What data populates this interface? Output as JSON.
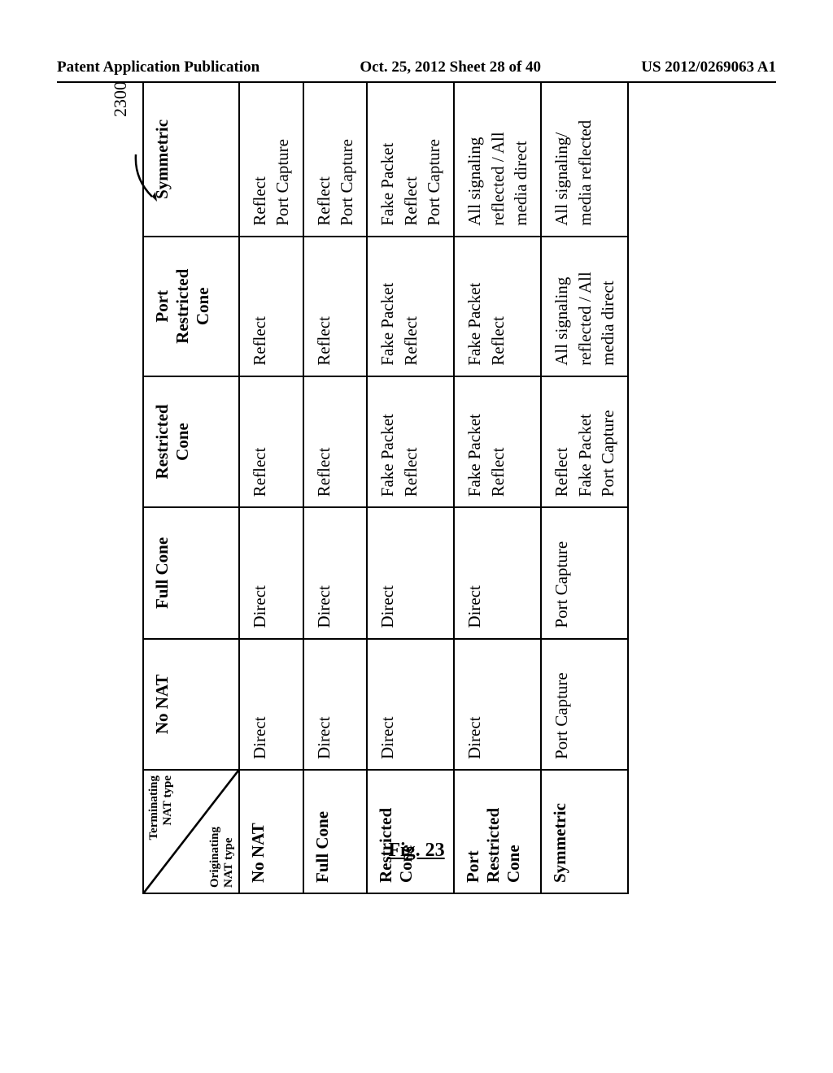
{
  "header": {
    "left": "Patent Application Publication",
    "center": "Oct. 25, 2012  Sheet 28 of 40",
    "right": "US 2012/0269063 A1"
  },
  "callout": "2300",
  "figure_caption": "Fig. 23",
  "diagonal": {
    "top": "Terminating\nNAT type",
    "bottom": "Originating\nNAT type"
  },
  "columns": [
    "No NAT",
    "Full Cone",
    "Restricted\nCone",
    "Port\nRestricted\nCone",
    "Symmetric"
  ],
  "rows": [
    {
      "label": "No NAT",
      "cells": [
        [
          "Direct"
        ],
        [
          "Direct"
        ],
        [
          "Reflect"
        ],
        [
          "Reflect"
        ],
        [
          "Reflect",
          "Port Capture"
        ]
      ]
    },
    {
      "label": "Full Cone",
      "cells": [
        [
          "Direct"
        ],
        [
          "Direct"
        ],
        [
          "Reflect"
        ],
        [
          "Reflect"
        ],
        [
          "Reflect",
          "Port Capture"
        ]
      ]
    },
    {
      "label": "Restricted\nCone",
      "cells": [
        [
          "Direct"
        ],
        [
          "Direct"
        ],
        [
          "Fake Packet",
          "Reflect"
        ],
        [
          "Fake Packet",
          "Reflect"
        ],
        [
          "Fake Packet",
          "Reflect",
          "Port Capture"
        ]
      ]
    },
    {
      "label": "Port\nRestricted\nCone",
      "cells": [
        [
          "Direct"
        ],
        [
          "Direct"
        ],
        [
          "Fake Packet",
          "Reflect"
        ],
        [
          "Fake Packet",
          "Reflect"
        ],
        [
          "All signaling",
          "reflected / All",
          "media direct"
        ]
      ]
    },
    {
      "label": "Symmetric",
      "cells": [
        [
          "Port Capture"
        ],
        [
          "Port Capture"
        ],
        [
          "Reflect",
          "Fake Packet",
          "Port Capture"
        ],
        [
          "All signaling",
          "reflected / All",
          "media direct"
        ],
        [
          "All signaling/",
          "media reflected"
        ]
      ]
    }
  ]
}
